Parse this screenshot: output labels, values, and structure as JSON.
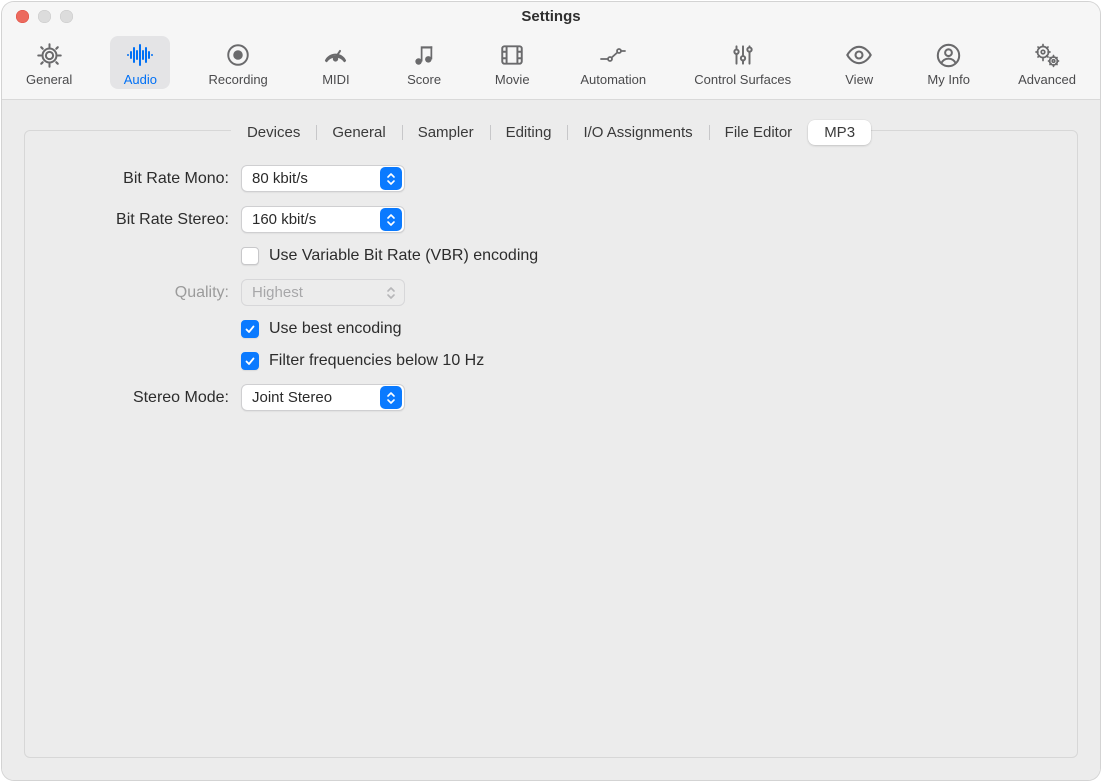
{
  "window": {
    "title": "Settings"
  },
  "toolbar": {
    "items": [
      {
        "id": "general",
        "label": "General"
      },
      {
        "id": "audio",
        "label": "Audio",
        "selected": true
      },
      {
        "id": "recording",
        "label": "Recording"
      },
      {
        "id": "midi",
        "label": "MIDI"
      },
      {
        "id": "score",
        "label": "Score"
      },
      {
        "id": "movie",
        "label": "Movie"
      },
      {
        "id": "automation",
        "label": "Automation"
      },
      {
        "id": "control-surfaces",
        "label": "Control Surfaces"
      },
      {
        "id": "view",
        "label": "View"
      },
      {
        "id": "my-info",
        "label": "My Info"
      },
      {
        "id": "advanced",
        "label": "Advanced"
      }
    ]
  },
  "tabs": [
    {
      "label": "Devices"
    },
    {
      "label": "General"
    },
    {
      "label": "Sampler"
    },
    {
      "label": "Editing"
    },
    {
      "label": "I/O Assignments"
    },
    {
      "label": "File Editor"
    },
    {
      "label": "MP3",
      "active": true
    }
  ],
  "form": {
    "bit_rate_mono": {
      "label": "Bit Rate Mono:",
      "value": "80 kbit/s"
    },
    "bit_rate_stereo": {
      "label": "Bit Rate Stereo:",
      "value": "160 kbit/s"
    },
    "vbr": {
      "label": "Use Variable Bit Rate (VBR) encoding",
      "checked": false
    },
    "quality": {
      "label": "Quality:",
      "value": "Highest",
      "disabled": true
    },
    "best_encoding": {
      "label": "Use best encoding",
      "checked": true
    },
    "filter_low": {
      "label": "Filter frequencies below 10 Hz",
      "checked": true
    },
    "stereo_mode": {
      "label": "Stereo Mode:",
      "value": "Joint Stereo"
    }
  }
}
